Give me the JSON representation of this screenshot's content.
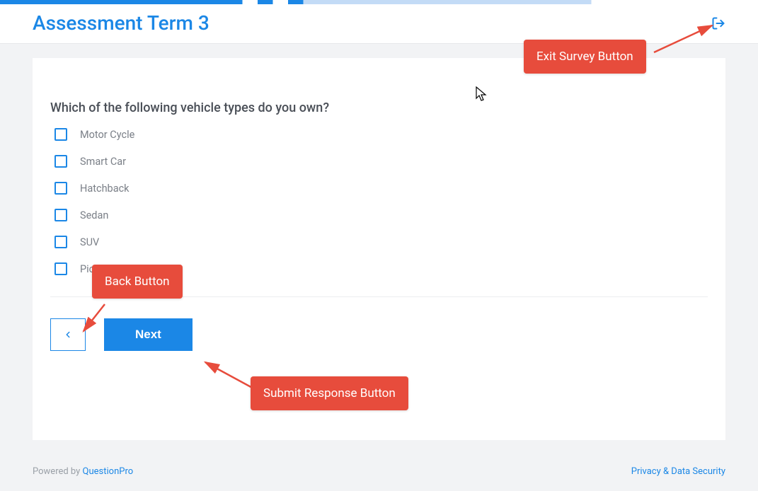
{
  "header": {
    "title": "Assessment Term 3"
  },
  "question": {
    "text": "Which of the following vehicle types do you own?",
    "options": [
      "Motor Cycle",
      "Smart Car",
      "Hatchback",
      "Sedan",
      "SUV",
      "Pic"
    ]
  },
  "buttons": {
    "next": "Next"
  },
  "footer": {
    "powered_prefix": "Powered by ",
    "powered_link": "QuestionPro",
    "privacy": "Privacy & Data Security"
  },
  "annotations": {
    "exit": "Exit Survey Button",
    "back": "Back Button",
    "submit": "Submit Response Button"
  }
}
